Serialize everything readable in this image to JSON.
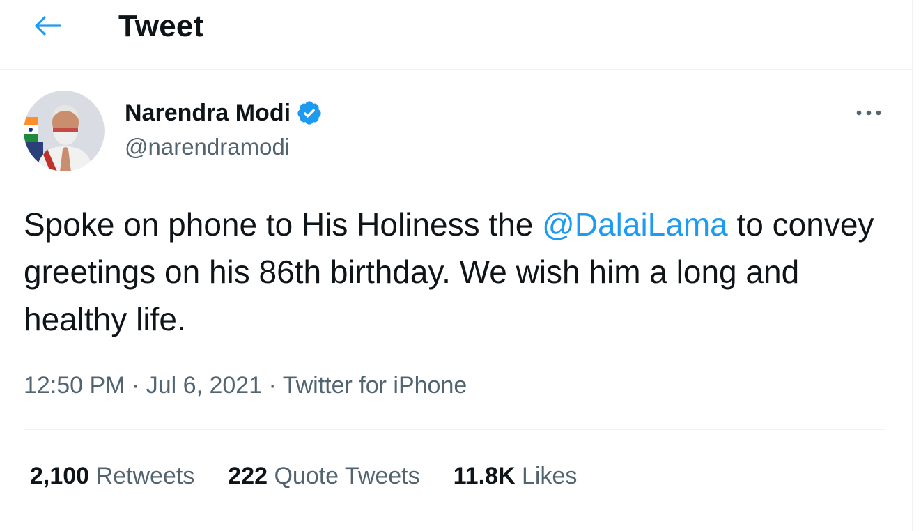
{
  "header": {
    "title": "Tweet",
    "back_icon": "arrow-left-icon"
  },
  "colors": {
    "accent": "#1d9bf0",
    "text": "#0f1419",
    "secondary": "#536471",
    "divider": "#eff3f4"
  },
  "author": {
    "name": "Narendra Modi",
    "handle": "@narendramodi",
    "verified": true,
    "verified_icon": "verified-badge-icon",
    "more_icon": "more-horizontal-icon"
  },
  "tweet": {
    "text_before": "Spoke on phone to His Holiness the ",
    "mention": "@DalaiLama",
    "text_after": " to convey greetings on his 86th birthday. We wish him a long and healthy life."
  },
  "meta": {
    "time": "12:50 PM",
    "separator": " · ",
    "date": "Jul 6, 2021",
    "source": "Twitter for iPhone"
  },
  "stats": {
    "retweets": {
      "count": "2,100",
      "label": "Retweets"
    },
    "quotes": {
      "count": "222",
      "label": "Quote Tweets"
    },
    "likes": {
      "count": "11.8K",
      "label": "Likes"
    }
  }
}
